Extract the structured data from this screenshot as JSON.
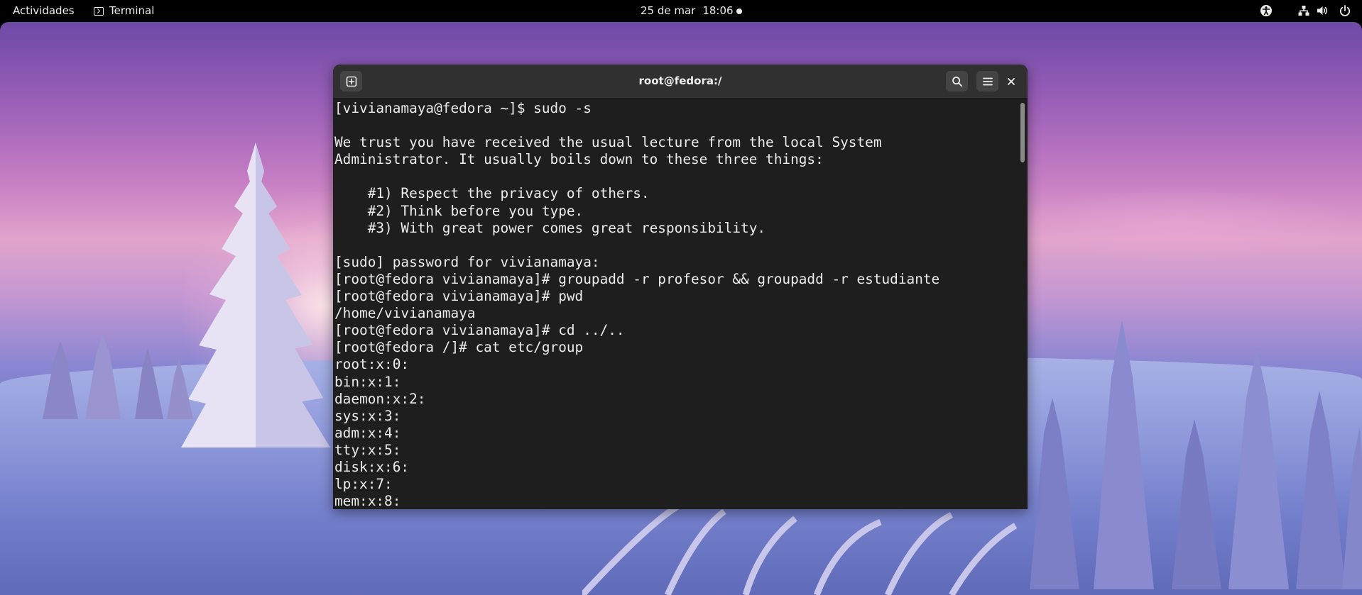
{
  "topbar": {
    "activities_label": "Actividades",
    "app_name": "Terminal",
    "date": "25 de mar",
    "time": "18:06",
    "tray_icons": [
      "accessibility-icon",
      "network-icon",
      "volume-icon",
      "power-icon"
    ]
  },
  "window": {
    "title": "root@fedora:/",
    "buttons": [
      "new-tab-icon",
      "search-icon",
      "menu-icon",
      "close-icon"
    ]
  },
  "terminal": {
    "lines": [
      "[vivianamaya@fedora ~]$ sudo -s",
      "",
      "We trust you have received the usual lecture from the local System",
      "Administrator. It usually boils down to these three things:",
      "",
      "    #1) Respect the privacy of others.",
      "    #2) Think before you type.",
      "    #3) With great power comes great responsibility.",
      "",
      "[sudo] password for vivianamaya:",
      "[root@fedora vivianamaya]# groupadd -r profesor && groupadd -r estudiante",
      "[root@fedora vivianamaya]# pwd",
      "/home/vivianamaya",
      "[root@fedora vivianamaya]# cd ../..",
      "[root@fedora /]# cat etc/group",
      "root:x:0:",
      "bin:x:1:",
      "daemon:x:2:",
      "sys:x:3:",
      "adm:x:4:",
      "tty:x:5:",
      "disk:x:6:",
      "lp:x:7:",
      "mem:x:8:"
    ]
  },
  "colors": {
    "topbar_bg": "#000000",
    "headerbar_bg": "#303030",
    "terminal_bg": "#1e1e1e",
    "terminal_fg": "#ececec"
  }
}
